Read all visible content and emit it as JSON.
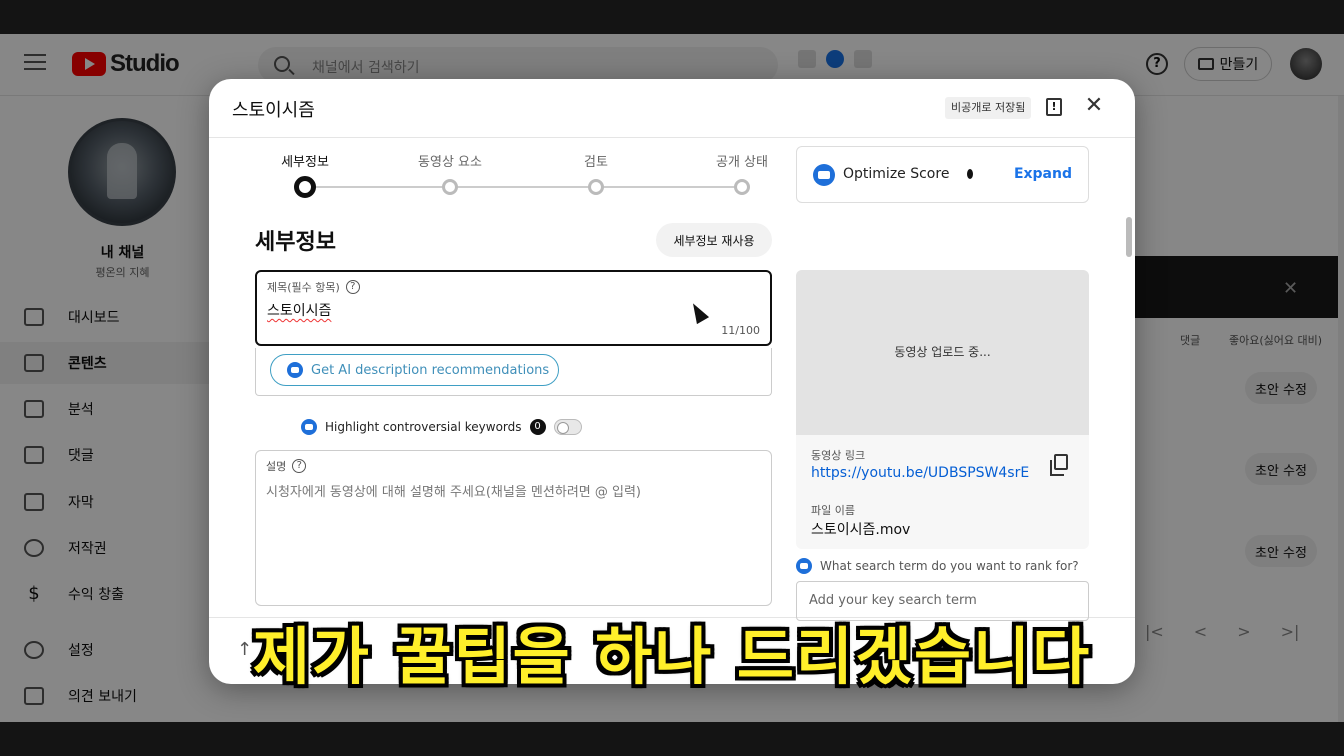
{
  "studio": {
    "logo_text": "Studio",
    "search_placeholder": "채널에서 검색하기",
    "help_label": "?",
    "create_label": "만들기",
    "channel_name": "내 채널",
    "channel_subtitle": "평온의 지혜",
    "nav": [
      {
        "label": "대시보드",
        "icon": "dashboard-icon",
        "active": false
      },
      {
        "label": "콘텐츠",
        "icon": "content-icon",
        "active": true
      },
      {
        "label": "분석",
        "icon": "analytics-icon",
        "active": false
      },
      {
        "label": "댓글",
        "icon": "comments-icon",
        "active": false
      },
      {
        "label": "자막",
        "icon": "subtitles-icon",
        "active": false
      },
      {
        "label": "저작권",
        "icon": "copyright-icon",
        "active": false
      },
      {
        "label": "수익 창출",
        "icon": "monetization-icon",
        "active": false
      },
      {
        "label": "설정",
        "icon": "settings-icon",
        "active": false
      },
      {
        "label": "의견 보내기",
        "icon": "feedback-icon",
        "active": false
      }
    ],
    "columns": {
      "comments": "댓글",
      "likes": "좋아요(싫어요 대비)"
    },
    "draft_label": "초안 수정",
    "pager": [
      "|<",
      "<",
      ">",
      ">|"
    ]
  },
  "modal": {
    "title": "스토이시즘",
    "saved_badge": "비공개로 저장됨",
    "feedback_glyph": "!",
    "close_glyph": "✕",
    "steps": [
      {
        "label": "세부정보",
        "active": true
      },
      {
        "label": "동영상 요소",
        "active": false
      },
      {
        "label": "검토",
        "active": false
      },
      {
        "label": "공개 상태",
        "active": false
      }
    ],
    "section_title": "세부정보",
    "reuse_button": "세부정보 재사용",
    "title_field": {
      "label": "제목(필수 항목)",
      "value": "스토이시즘",
      "char_count": "11/100"
    },
    "ai_button": "Get AI description recommendations",
    "highlight": {
      "label": "Highlight controversial keywords",
      "count": "0",
      "enabled": false
    },
    "description_field": {
      "label": "설명",
      "placeholder": "시청자에게 동영상에 대해 설명해 주세요(채널을 멘션하려면 @ 입력)"
    },
    "optimize": {
      "label": "Optimize Score",
      "expand": "Expand"
    },
    "preview": {
      "status": "동영상 업로드 중...",
      "link_label": "동영상 링크",
      "link_value": "https://youtu.be/UDBSPSW4srE",
      "file_label": "파일 이름",
      "file_value": "스토이시즘.mov"
    },
    "rank_prompt": "What search term do you want to rank for?",
    "keyword_placeholder": "Add your key search term"
  },
  "caption": "제가 꿀팁을 하나 드리겠습니다",
  "colors": {
    "caption": "#ffef2a",
    "accent_link": "#065fd4",
    "ai_button": "#3f8fb9",
    "youtube_red": "#ff0000"
  }
}
